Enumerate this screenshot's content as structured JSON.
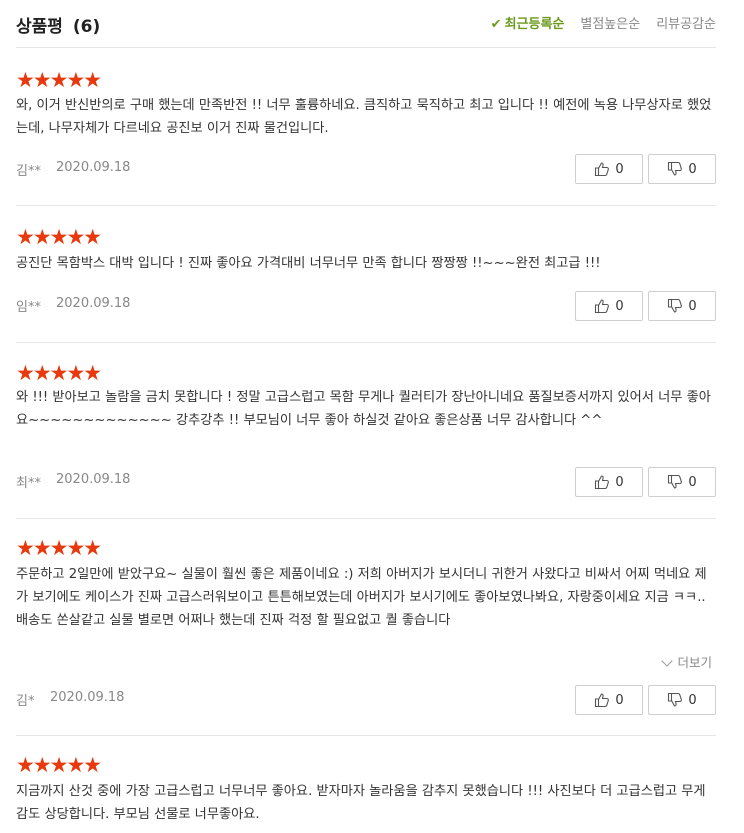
{
  "header": {
    "title": "상품평",
    "count": "(6)",
    "sort_options": [
      "최근등록순",
      "별점높은순",
      "리뷰공감순"
    ],
    "active_sort_index": 0
  },
  "rating_color": "#e8380d",
  "active_color": "#6b9a1d",
  "reviews": [
    {
      "stars": "★★★★★",
      "rating": 5,
      "text": "와, 이거 반신반의로 구매 했는데 만족반전 !! 너무 훌륭하네요. 큼직하고 묵직하고 최고 입니다 !! 예전에 녹용 나무상자로 했었는데, 나무자체가 다르네요 공진보 이거 진짜 물건입니다.",
      "author": "김**",
      "date": "2020.09.18",
      "likes": "0",
      "dislikes": "0"
    },
    {
      "stars": "★★★★★",
      "rating": 5,
      "text": "공진단 목함박스 대박 입니다 ! 진짜 좋아요 가격대비 너무너무 만족 합니다 짱짱짱 !!~~~완전 최고급 !!!",
      "author": "임**",
      "date": "2020.09.18",
      "likes": "0",
      "dislikes": "0"
    },
    {
      "stars": "★★★★★",
      "rating": 5,
      "text": "와 !!! 받아보고 놀람을 금치 못합니다 ! 정말 고급스럽고 목함 무게나 퀄러티가 장난아니네요 품질보증서까지 있어서 너무 좋아요~~~~~~~~~~~~~ 강추강추 !! 부모님이 너무 좋아 하실것 같아요 좋은상품 너무 감사합니다 ^^",
      "author": "최**",
      "date": "2020.09.18",
      "likes": "0",
      "dislikes": "0"
    },
    {
      "stars": "★★★★★",
      "rating": 5,
      "text": "주문하고 2일만에 받았구요~ 실물이 훨씬 좋은 제품이네요 :) 저희 아버지가 보시더니 귀한거 사왔다고 비싸서 어찌 먹네요 제가 보기에도 케이스가 진짜 고급스러워보이고 튼튼해보였는데 아버지가 보시기에도 좋아보였나봐요, 자랑중이세요 지금 ㅋㅋ.. 배송도 쏜살같고 실물 별로면 어쩌나 했는데 진짜 걱정 할 필요없고 퀄 좋습니다",
      "more_label": "더보기",
      "author": "김*",
      "date": "2020.09.18",
      "likes": "0",
      "dislikes": "0"
    },
    {
      "stars": "★★★★★",
      "rating": 5,
      "text": "지금까지 산것 중에 가장 고급스럽고 너무너무 좋아요. 받자마자 놀라움을 감추지 못했습니다 !!! 사진보다 더 고급스럽고 무게감도 상당합니다. 부모님 선물로 너무좋아요."
    }
  ]
}
